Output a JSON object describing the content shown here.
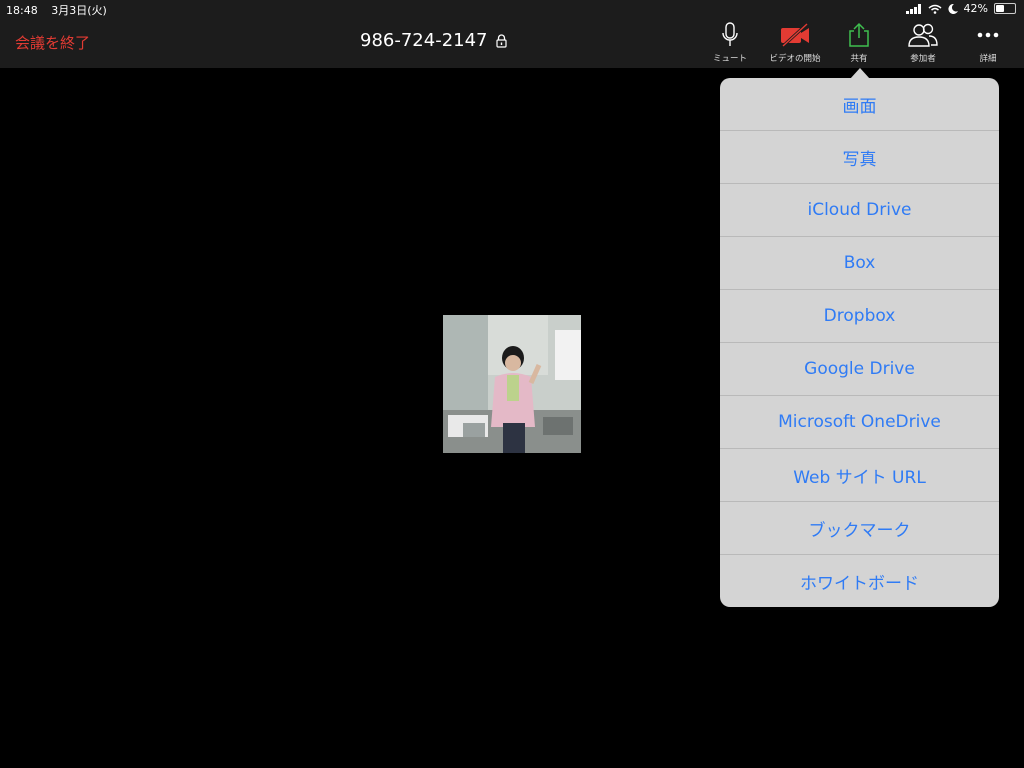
{
  "status_bar": {
    "time": "18:48",
    "date": "3月3日(火)",
    "battery": "42%",
    "battery_level": 0.42
  },
  "toolbar": {
    "end_meeting": "会議を終了",
    "meeting_id": "986-724-2147",
    "buttons": [
      {
        "label": "ミュート",
        "icon": "microphone-icon"
      },
      {
        "label": "ビデオの開始",
        "icon": "video-off-icon",
        "color": "#e23b33"
      },
      {
        "label": "共有",
        "icon": "share-icon",
        "color": "#3fbf4f"
      },
      {
        "label": "参加者",
        "icon": "participants-icon"
      },
      {
        "label": "詳細",
        "icon": "more-icon"
      }
    ]
  },
  "share_menu": {
    "items": [
      {
        "label": "画面"
      },
      {
        "label": "写真"
      },
      {
        "label": "iCloud Drive"
      },
      {
        "label": "Box"
      },
      {
        "label": "Dropbox"
      },
      {
        "label": "Google Drive"
      },
      {
        "label": "Microsoft OneDrive"
      },
      {
        "label": "Web サイト URL"
      },
      {
        "label": "ブックマーク"
      },
      {
        "label": "ホワイトボード"
      }
    ]
  },
  "colors": {
    "accent_red": "#e23b33",
    "accent_green": "#3fbf4f",
    "menu_text": "#2f7bf5"
  }
}
